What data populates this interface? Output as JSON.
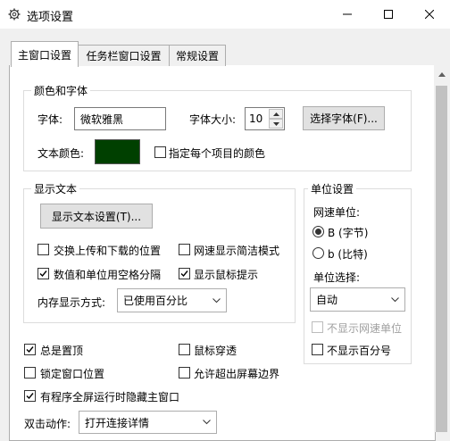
{
  "window": {
    "title": "选项设置"
  },
  "tabs": [
    {
      "label": "主窗口设置",
      "active": true
    },
    {
      "label": "任务栏窗口设置",
      "active": false
    },
    {
      "label": "常规设置",
      "active": false
    }
  ],
  "colors_fonts": {
    "group_label": "颜色和字体",
    "font_label": "字体:",
    "font_value": "微软雅黑",
    "font_size_label": "字体大小:",
    "font_size_value": "10",
    "choose_font_button": "选择字体(F)...",
    "text_color_label": "文本颜色:",
    "text_color_value": "#004000",
    "per_item_color_label": "指定每个项目的颜色",
    "per_item_color_checked": false
  },
  "display_text": {
    "group_label": "显示文本",
    "settings_button": "显示文本设置(T)...",
    "swap_updown": {
      "label": "交换上传和下载的位置",
      "checked": false
    },
    "simple_mode": {
      "label": "网速显示简洁模式",
      "checked": false
    },
    "space_separate": {
      "label": "数值和单位用空格分隔",
      "checked": true
    },
    "mouse_tip": {
      "label": "显示鼠标提示",
      "checked": true
    },
    "memory_label": "内存显示方式:",
    "memory_value": "已使用百分比"
  },
  "units": {
    "group_label": "单位设置",
    "speed_unit_label": "网速单位:",
    "byte_option": "B (字节)",
    "bit_option": "b (比特)",
    "selected": "B (字节)",
    "unit_select_label": "单位选择:",
    "unit_select_value": "自动",
    "hide_speed_unit": {
      "label": "不显示网速单位",
      "checked": false,
      "disabled": true
    },
    "hide_percent": {
      "label": "不显示百分号",
      "checked": false
    }
  },
  "general": {
    "always_on_top": {
      "label": "总是置顶",
      "checked": true
    },
    "click_through": {
      "label": "鼠标穿透",
      "checked": false
    },
    "lock_position": {
      "label": "锁定窗口位置",
      "checked": false
    },
    "allow_offscreen": {
      "label": "允许超出屏幕边界",
      "checked": false
    },
    "hide_fullscreen": {
      "label": "有程序全屏运行时隐藏主窗口",
      "checked": true
    },
    "double_click_label": "双击动作:",
    "double_click_value": "打开连接详情"
  }
}
